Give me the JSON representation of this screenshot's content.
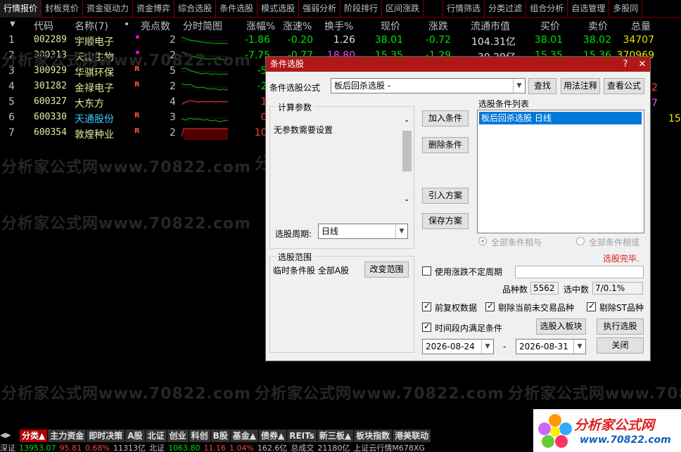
{
  "top_tabs": [
    "行情报价",
    "封板竞价",
    "资金驱动力",
    "资金博弈",
    "综合选股",
    "条件选股",
    "模式选股",
    "强弱分析",
    "阶段排行",
    "区间涨跌",
    "行情筛选",
    "分类过滤",
    "组合分析",
    "自选管理",
    "多股同"
  ],
  "columns": {
    "code": "代码",
    "name": "名称(7)",
    "dot": "•",
    "highlight": "亮点数",
    "intraday": "分时简图",
    "change_pct": "涨幅%",
    "speed": "涨速%",
    "turnover": "换手%",
    "price": "现价",
    "change": "涨跌",
    "float_cap": "流通市值",
    "bid": "买价",
    "ask": "卖价",
    "volume": "总量"
  },
  "rows": [
    {
      "idx": "1",
      "code": "002289",
      "name": "宇顺电子",
      "flag": "•",
      "cnt": "2",
      "pct": "-1.86",
      "speed": "-0.20",
      "turn": "1.26",
      "price": "38.01",
      "chg": "-0.72",
      "cap": "104.31亿",
      "bid": "38.01",
      "ask": "38.02",
      "vol": "34707"
    },
    {
      "idx": "2",
      "code": "300313",
      "name": "天山生物",
      "flag": "•",
      "cnt": "2",
      "pct": "-7.75",
      "speed": "-0.77",
      "turn": "18.80",
      "price": "15.35",
      "chg": "-1.29",
      "cap": "30.29亿",
      "bid": "15.35",
      "ask": "15.36",
      "vol": "370969"
    },
    {
      "idx": "3",
      "code": "300929",
      "name": "华骐环保",
      "flag": "R",
      "cnt": "5",
      "pct": "-5.",
      "speed": "",
      "turn": "",
      "price": "",
      "chg": "",
      "cap": "",
      "bid": "",
      "ask": "",
      "vol": ""
    },
    {
      "idx": "4",
      "code": "301282",
      "name": "金禄电子",
      "flag": "R",
      "cnt": "2",
      "pct": "-2.",
      "speed": "",
      "turn": "",
      "price": "",
      "chg": "",
      "cap": "",
      "bid": "",
      "ask": "",
      "vol": ""
    },
    {
      "idx": "5",
      "code": "600327",
      "name": "大东方",
      "flag": "",
      "cnt": "4",
      "pct": "1.",
      "speed": "",
      "turn": "",
      "price": "",
      "chg": "",
      "cap": "",
      "bid": "",
      "ask": "",
      "vol": ""
    },
    {
      "idx": "6",
      "code": "600330",
      "name": "天通股份",
      "flag": "R",
      "cnt": "3",
      "pct": "0.",
      "speed": "",
      "turn": "",
      "price": "",
      "chg": "",
      "cap": "",
      "bid": "",
      "ask": "",
      "vol": ""
    },
    {
      "idx": "7",
      "code": "600354",
      "name": "敦煌种业",
      "flag": "R",
      "cnt": "2",
      "pct": "10.",
      "speed": "",
      "turn": "",
      "price": "",
      "chg": "",
      "cap": "",
      "bid": "",
      "ask": "",
      "vol": ""
    }
  ],
  "right_edge": {
    "r3": "2",
    "r5": "7",
    "r6": "15"
  },
  "watermark": "分析家公式网www.70822.com",
  "dialog": {
    "title": "条件选股",
    "formula_label": "条件选股公式",
    "formula_value": "板后回杀选股  -",
    "btn_find": "查找",
    "btn_usage": "用法注释",
    "btn_view": "查看公式",
    "params_legend": "计算参数",
    "params_text": "无参数需要设置",
    "period_label": "选股周期:",
    "period_value": "日线",
    "range_legend": "选股范围",
    "range_text": "临时条件股 全部A股",
    "btn_change_range": "改变范围",
    "btn_add": "加入条件",
    "btn_delete": "删除条件",
    "btn_import": "引入方案",
    "btn_save": "保存方案",
    "list_label": "选股条件列表",
    "list_item": "板后回杀选股  日线",
    "radio_and": "全部条件相与",
    "radio_or": "全部条件相或",
    "status": "选股完毕.",
    "chk_uncertain": "使用涨跌不定周期",
    "count_label": "品种数",
    "count_value": "5562",
    "hit_label": "选中数",
    "hit_value": "7/0.1%",
    "chk_adjust": "前复权数据",
    "chk_exclude_untraded": "剔除当前未交易品种",
    "chk_exclude_st": "剔除ST品种",
    "chk_period": "时间段内满足条件",
    "btn_to_block": "选股入板块",
    "btn_run": "执行选股",
    "date_from": "2026-08-24",
    "date_sep": "-",
    "date_to": "2026-08-31",
    "btn_close": "关闭"
  },
  "bottom_tabs": [
    "分类▲",
    "主力资金",
    "即时决策",
    "A股",
    "北证",
    "创业",
    "科创",
    "B股",
    "基金▲",
    "债券▲",
    "REITs",
    "新三板▲",
    "板块指数",
    "港美联动"
  ],
  "status_items": [
    "深证",
    "13953.07",
    "95.81",
    "0.68%",
    "11313亿",
    "北证",
    "1063.80",
    "11.16",
    "1.04%",
    "162.6亿",
    "总成交",
    "21180亿",
    "上证云行情M678XG"
  ],
  "logo": {
    "brand": "分析家公式网",
    "url": "www.70822.com"
  },
  "colors": {
    "up": "#ff4040",
    "down": "#00e000",
    "title_bar": "#b01818",
    "selection": "#0078d7"
  }
}
